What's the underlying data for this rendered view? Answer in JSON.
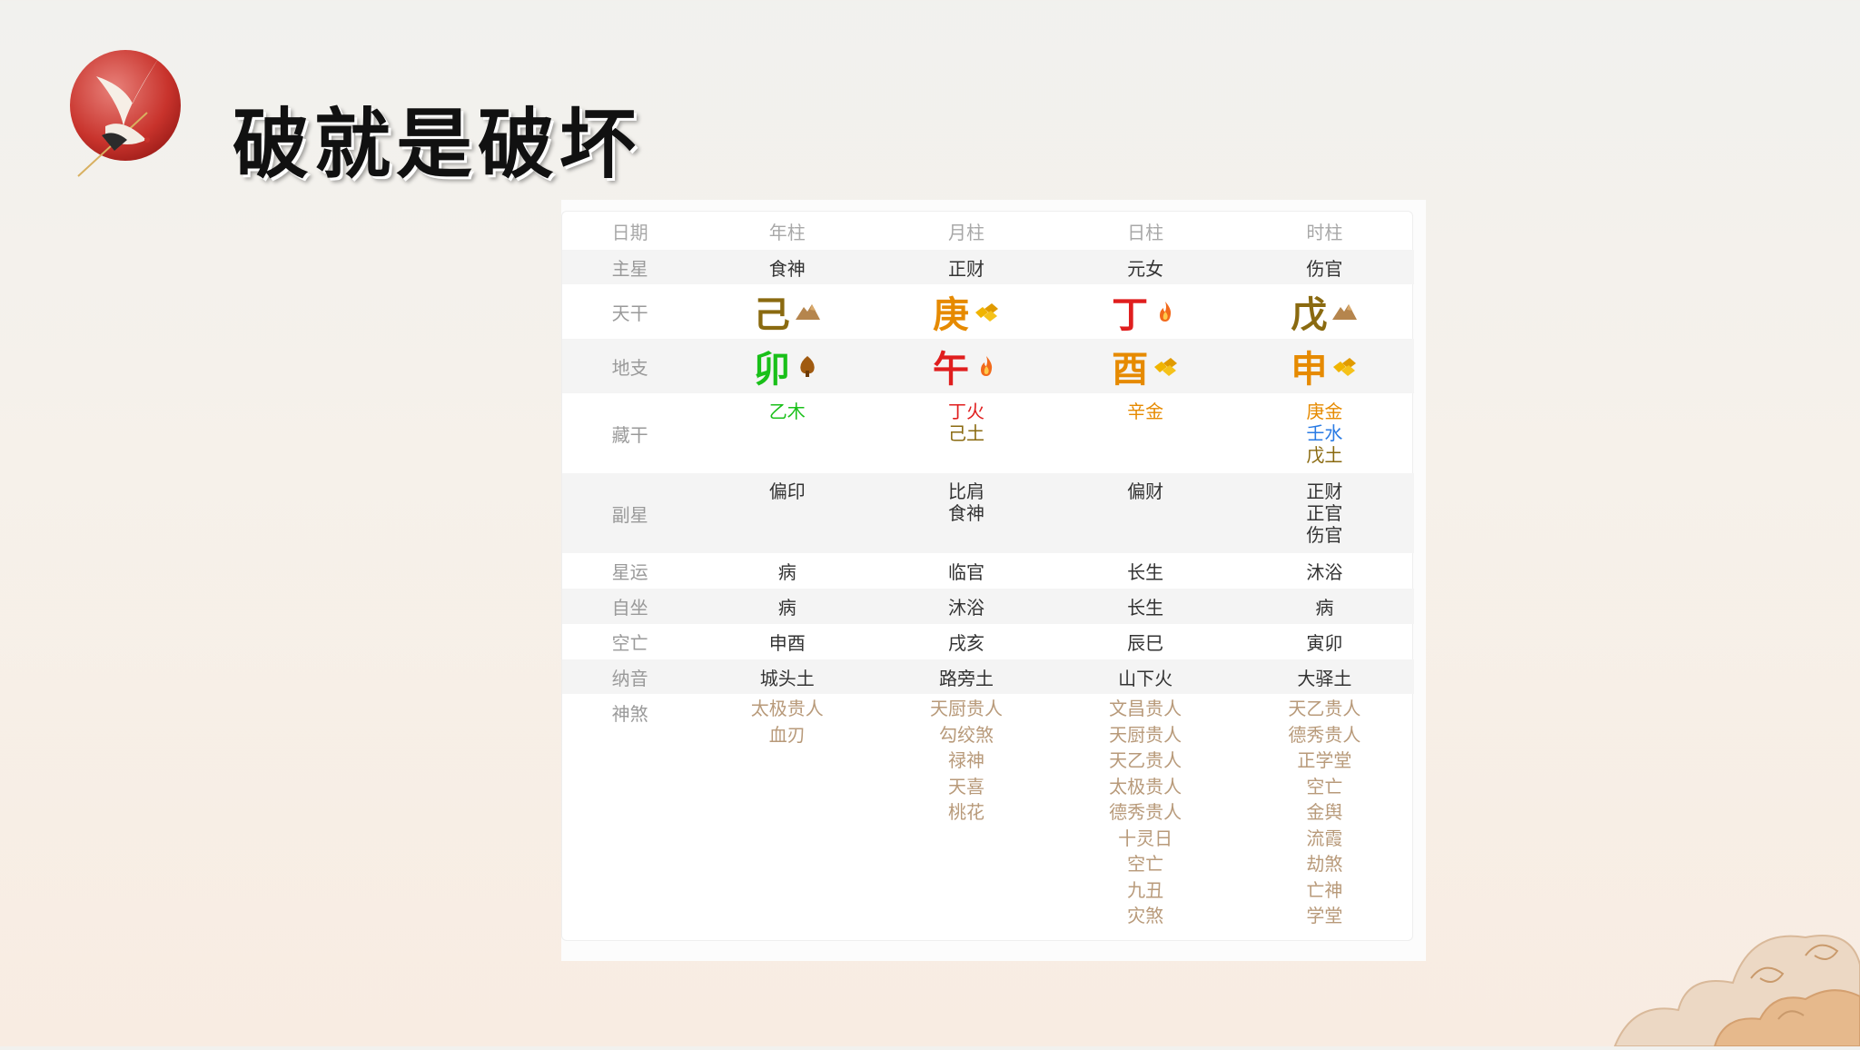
{
  "page": {
    "title": "破就是破坏"
  },
  "table": {
    "header": {
      "label": "日期",
      "columns": [
        "年柱",
        "月柱",
        "日柱",
        "时柱"
      ]
    },
    "main_star": {
      "label": "主星",
      "values": [
        "食神",
        "正财",
        "元女",
        "伤官"
      ]
    },
    "heavenly_stem": {
      "label": "天干",
      "values": [
        {
          "char": "己",
          "color": "#8a6a10",
          "icon": "earth-mountain-icon"
        },
        {
          "char": "庚",
          "color": "#e68a00",
          "icon": "metal-gold-icon"
        },
        {
          "char": "丁",
          "color": "#e01e1e",
          "icon": "fire-icon"
        },
        {
          "char": "戊",
          "color": "#8a6a10",
          "icon": "earth-mountain-icon"
        }
      ]
    },
    "earthly_branch": {
      "label": "地支",
      "values": [
        {
          "char": "卯",
          "color": "#19c019",
          "icon": "wood-tree-icon"
        },
        {
          "char": "午",
          "color": "#e01e1e",
          "icon": "fire-icon"
        },
        {
          "char": "酉",
          "color": "#e68a00",
          "icon": "metal-gold-icon"
        },
        {
          "char": "申",
          "color": "#e68a00",
          "icon": "metal-gold-icon"
        }
      ]
    },
    "hidden_stems": {
      "label": "藏干",
      "values": [
        [
          {
            "text": "乙木",
            "color": "#19c019"
          }
        ],
        [
          {
            "text": "丁火",
            "color": "#e01e1e"
          },
          {
            "text": "己土",
            "color": "#8a6a10"
          }
        ],
        [
          {
            "text": "辛金",
            "color": "#e68a00"
          }
        ],
        [
          {
            "text": "庚金",
            "color": "#e68a00"
          },
          {
            "text": "壬水",
            "color": "#2a7be4"
          },
          {
            "text": "戊土",
            "color": "#8a6a10"
          }
        ]
      ]
    },
    "sub_star": {
      "label": "副星",
      "values": [
        [
          "偏印"
        ],
        [
          "比肩",
          "食神"
        ],
        [
          "偏财"
        ],
        [
          "正财",
          "正官",
          "伤官"
        ]
      ]
    },
    "star_luck": {
      "label": "星运",
      "values": [
        "病",
        "临官",
        "长生",
        "沐浴"
      ]
    },
    "self_seat": {
      "label": "自坐",
      "values": [
        "病",
        "沐浴",
        "长生",
        "病"
      ]
    },
    "void": {
      "label": "空亡",
      "values": [
        "申酉",
        "戌亥",
        "辰巳",
        "寅卯"
      ]
    },
    "nayin": {
      "label": "纳音",
      "values": [
        "城头土",
        "路旁土",
        "山下火",
        "大驿土"
      ]
    },
    "shensha": {
      "label": "神煞",
      "values": [
        [
          "太极贵人",
          "血刃"
        ],
        [
          "天厨贵人",
          "勾绞煞",
          "禄神",
          "天喜",
          "桃花"
        ],
        [
          "文昌贵人",
          "天厨贵人",
          "天乙贵人",
          "太极贵人",
          "德秀贵人",
          "十灵日",
          "空亡",
          "九丑",
          "灾煞"
        ],
        [
          "天乙贵人",
          "德秀贵人",
          "正学堂",
          "空亡",
          "金舆",
          "流霞",
          "劫煞",
          "亡神",
          "学堂"
        ]
      ]
    }
  }
}
